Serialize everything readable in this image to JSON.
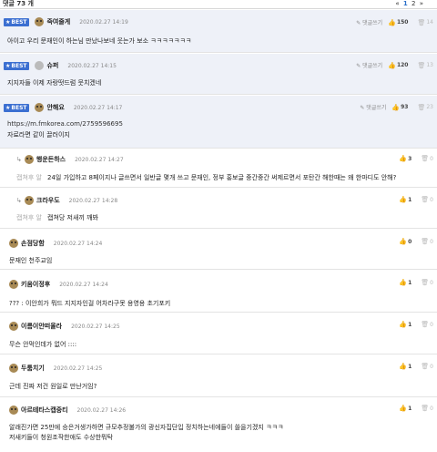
{
  "header": {
    "count_label": "댓글 73 개",
    "pager_prev": "«",
    "pager_1": "1",
    "pager_2": "2",
    "pager_next": "»"
  },
  "ui": {
    "best_badge": "BEST",
    "reply_button": "댓글쓰기",
    "reply_arrow": "↳",
    "star": "★",
    "up": "👍",
    "down": "🗑"
  },
  "comments": [
    {
      "nick": "죽여줄게",
      "date": "2020.02.27 14:19",
      "text": "아이고 우리 문재인이 하는님 만났나보네 웃는가 보소 ㅋㅋㅋㅋㅋㅋㅋ",
      "up": "150",
      "down": "14"
    },
    {
      "nick": "슈퍼",
      "date": "2020.02.27 14:15",
      "text": "지지자들 이제 자랑떳드럼 뭇치겠네",
      "up": "120",
      "down": "13"
    },
    {
      "nick": "안해요",
      "date": "2020.02.27 14:17",
      "link": "https://m.fmkorea.com/2759596695",
      "text": "자료라면 같이 끌러이지",
      "up": "93",
      "down": "23"
    },
    {
      "nick": "행운돈하스",
      "date": "2020.02.27 14:27",
      "tag": "캡쳐후 알",
      "text": "24일 가입하고 8페이지나 글쓰면서 일반글 몇개 쓰고 문재인, 정부 홍보글 중간중간 써제르면서 포탄간 해한때는 왜 한마디도 안해?",
      "up": "3",
      "down": "0"
    },
    {
      "nick": "크라우도",
      "date": "2020.02.27 14:28",
      "tag": "캡쳐후 알",
      "text": "캡쳐당 저새끼 깨봐",
      "up": "1",
      "down": "0"
    },
    {
      "nick": "손점당함",
      "date": "2020.02.27 14:24",
      "text": "문재인 천주교임",
      "up": "0",
      "down": "0"
    },
    {
      "nick": "키움이정후",
      "date": "2020.02.27 14:24",
      "text": "??? : 이안희가 뭐드 지지자인걸 어차라구못 용영용 초기포키",
      "up": "1",
      "down": "0"
    },
    {
      "nick": "이름이안떠올라",
      "date": "2020.02.27 14:25",
      "text": "무슨 안먹인데가 없어 ::::",
      "up": "1",
      "down": "0"
    },
    {
      "nick": "두툼치기",
      "date": "2020.02.27 14:25",
      "text": "근데 진짜 저건 원일로 만난거임?",
      "up": "1",
      "down": "0"
    },
    {
      "nick": "아르테타스캡중티",
      "date": "2020.02.27 14:26",
      "text": "알래진가면 25만에 승은거생가하면 규모추정불가의 광신자집단입 정치하는네에들이 쓸을기겠지 ㅋㅋㅋ",
      "text2": "저새키들이 청원조작한애도 수상한뭐탁",
      "up": "1",
      "down": "0"
    }
  ],
  "colors": {
    "best_bg": "#eef1f8",
    "badge": "#3b6fd1",
    "accent": "#2a6fc9"
  }
}
